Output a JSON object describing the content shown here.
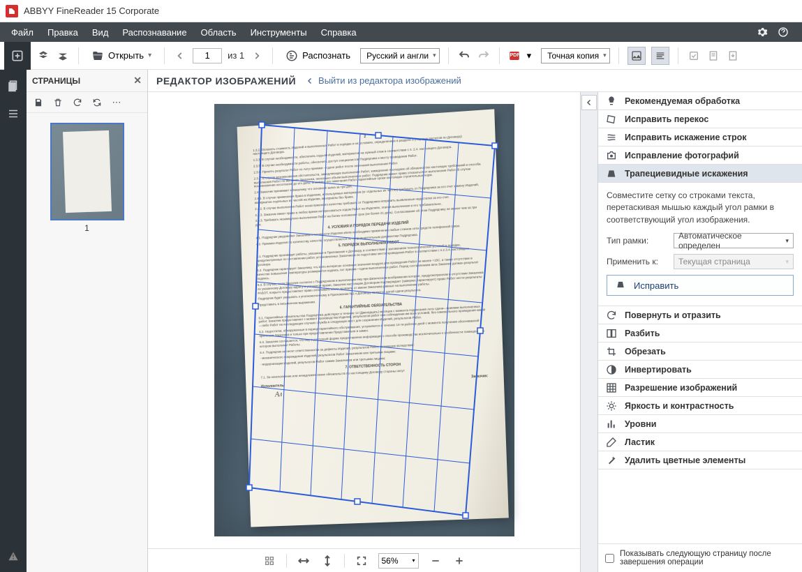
{
  "app": {
    "title": "ABBYY FineReader 15 Corporate"
  },
  "menu": {
    "items": [
      "Файл",
      "Правка",
      "Вид",
      "Распознавание",
      "Область",
      "Инструменты",
      "Справка"
    ]
  },
  "toolbar": {
    "open": "Открыть",
    "page_current": "1",
    "page_of": "из 1",
    "recognize": "Распознать",
    "lang_combo": "Русский и англи",
    "export_combo": "Точная копия"
  },
  "pages": {
    "title": "СТРАНИЦЫ",
    "thumb_num": "1"
  },
  "editor": {
    "title": "РЕДАКТОР ИЗОБРАЖЕНИЙ",
    "back": "Выйти из редактора изображений"
  },
  "canvas": {
    "zoom": "56%"
  },
  "tools": {
    "items": [
      "Рекомендуемая обработка",
      "Исправить перекос",
      "Исправить искажение строк",
      "Исправление фотографий",
      "Трапециевидные искажения",
      "Повернуть и отразить",
      "Разбить",
      "Обрезать",
      "Инвертировать",
      "Разрешение изображений",
      "Яркость и контрастность",
      "Уровни",
      "Ластик",
      "Удалить цветные элементы"
    ],
    "trapezoid": {
      "hint": "Совместите сетку со строками текста, перетаскивая мышью каждый угол рамки в соответствующий угол изображения.",
      "frame_type_label": "Тип рамки:",
      "frame_type_value": "Автоматическое определен",
      "apply_to_label": "Применить к:",
      "apply_to_value": "Текущая страница",
      "fix_button": "Исправить"
    },
    "footer_checkbox": "Показывать следующую страницу после завершения операции"
  }
}
